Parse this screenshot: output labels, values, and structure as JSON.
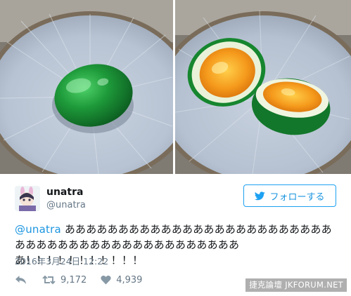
{
  "photos": [
    {
      "name": "whole-green-egg-photo"
    },
    {
      "name": "cut-green-egg-photo"
    }
  ],
  "user": {
    "display_name": "unatra",
    "handle": "@unatra"
  },
  "follow_button": {
    "label": "フォローする",
    "icon": "twitter-bird-icon"
  },
  "tweet": {
    "mention": "@unatra",
    "body": " あああああああああああああああああああああああああああああああああああああああああああああああ！！！！！！！！！！！"
  },
  "timestamp": "2016年3月24日 12:22",
  "actions": {
    "reply_icon": "reply-icon",
    "retweet_icon": "retweet-icon",
    "retweet_count": "9,172",
    "like_icon": "heart-icon",
    "like_count": "4,939"
  },
  "watermark": "捷克論壇 JKFORUM.NET",
  "colors": {
    "link": "#1b95e0",
    "muted": "#657786",
    "egg_white_green": "#1f9a3c",
    "yolk": "#f5a623"
  }
}
